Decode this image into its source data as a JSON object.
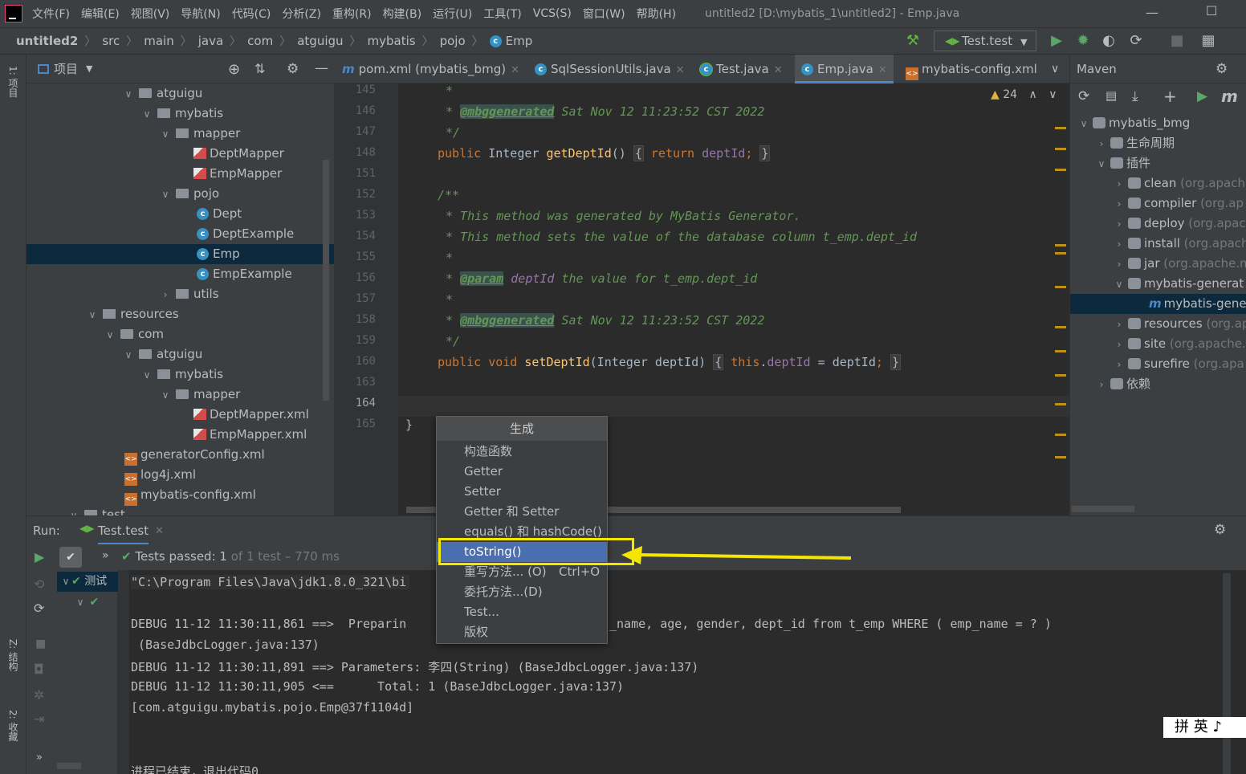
{
  "menu": [
    "文件(F)",
    "编辑(E)",
    "视图(V)",
    "导航(N)",
    "代码(C)",
    "分析(Z)",
    "重构(R)",
    "构建(B)",
    "运行(U)",
    "工具(T)",
    "VCS(S)",
    "窗口(W)",
    "帮助(H)"
  ],
  "window_title": "untitled2 [D:\\mybatis_1\\untitled2] - Emp.java",
  "breadcrumb": [
    "untitled2",
    "src",
    "main",
    "java",
    "com",
    "atguigu",
    "mybatis",
    "pojo",
    "Emp"
  ],
  "run_config": "Test.test",
  "side_labels": {
    "project": "1: 项目",
    "structure": "Z: 结构",
    "favorites": "2: 收藏"
  },
  "project_panel": {
    "title": "项目",
    "tree": [
      {
        "label": "atguigu",
        "type": "folder",
        "expanded": true
      },
      {
        "label": "mybatis",
        "type": "folder",
        "expanded": true
      },
      {
        "label": "mapper",
        "type": "folder",
        "expanded": true
      },
      {
        "label": "DeptMapper",
        "type": "mapper"
      },
      {
        "label": "EmpMapper",
        "type": "mapper"
      },
      {
        "label": "pojo",
        "type": "folder",
        "expanded": true
      },
      {
        "label": "Dept",
        "type": "class"
      },
      {
        "label": "DeptExample",
        "type": "class"
      },
      {
        "label": "Emp",
        "type": "class",
        "selected": true
      },
      {
        "label": "EmpExample",
        "type": "class"
      },
      {
        "label": "utils",
        "type": "folder",
        "expanded": false
      },
      {
        "label": "resources",
        "type": "folder",
        "expanded": true
      },
      {
        "label": "com",
        "type": "folder",
        "expanded": true
      },
      {
        "label": "atguigu",
        "type": "folder",
        "expanded": true
      },
      {
        "label": "mybatis",
        "type": "folder",
        "expanded": true
      },
      {
        "label": "mapper",
        "type": "folder",
        "expanded": true
      },
      {
        "label": "DeptMapper.xml",
        "type": "mapper"
      },
      {
        "label": "EmpMapper.xml",
        "type": "mapper"
      },
      {
        "label": "generatorConfig.xml",
        "type": "xml"
      },
      {
        "label": "log4j.xml",
        "type": "xml"
      },
      {
        "label": "mybatis-config.xml",
        "type": "xml"
      },
      {
        "label": "test",
        "type": "folder",
        "expanded": true
      }
    ]
  },
  "editor_tabs": [
    {
      "label": "pom.xml (mybatis_bmg)",
      "icon": "m"
    },
    {
      "label": "SqlSessionUtils.java",
      "icon": "c"
    },
    {
      "label": "Test.java",
      "icon": "c"
    },
    {
      "label": "Emp.java",
      "icon": "c",
      "active": true
    },
    {
      "label": "mybatis-config.xml",
      "icon": "xml"
    }
  ],
  "warnings_count": "24",
  "code_lines": [
    {
      "n": "145",
      "t": " *"
    },
    {
      "n": "146",
      "t": " * @mbggenerated Sat Nov 12 11:23:52 CST 2022"
    },
    {
      "n": "147",
      "t": " */"
    },
    {
      "n": "148",
      "t": "public Integer getDeptId() { return deptId; }"
    },
    {
      "n": "151",
      "t": ""
    },
    {
      "n": "152",
      "t": "/**"
    },
    {
      "n": "153",
      "t": " * This method was generated by MyBatis Generator."
    },
    {
      "n": "154",
      "t": " * This method sets the value of the database column t_emp.dept_id"
    },
    {
      "n": "155",
      "t": " *"
    },
    {
      "n": "156",
      "t": " * @param deptId the value for t_emp.dept_id"
    },
    {
      "n": "157",
      "t": " *"
    },
    {
      "n": "158",
      "t": " * @mbggenerated Sat Nov 12 11:23:52 CST 2022"
    },
    {
      "n": "159",
      "t": " */"
    },
    {
      "n": "160",
      "t": "public void setDeptId(Integer deptId) { this.deptId = deptId; }"
    },
    {
      "n": "163",
      "t": ""
    },
    {
      "n": "164",
      "t": ""
    },
    {
      "n": "165",
      "t": "}"
    }
  ],
  "code_parts": {
    "star": "*",
    "tag_mbg": "@mbggenerated",
    "date": " Sat Nov 12 11:23:52 CST 2022",
    "close": "*/",
    "kw_public": "public",
    "type_integer": "Integer",
    "m_get": "getDeptId",
    "paren": "()",
    "ob": "{",
    "kw_return": "return",
    "f_deptId": "deptId",
    "semi": ";",
    "cb": "}",
    "open": "/**",
    "c153": "* This method was generated by MyBatis Generator.",
    "c154": "* This method sets the value of the database column t_emp.dept_id",
    "tag_param": "@param",
    "p_deptId": "deptId",
    "c156": " the value for t_emp.dept_id",
    "kw_void": "void",
    "m_set": "setDeptId",
    "sig_set": "(Integer deptId)",
    "kw_this": "this",
    "dot": ".",
    "eq": " = ",
    "endbrace": "}"
  },
  "maven": {
    "title": "Maven",
    "tree": [
      {
        "label": "mybatis_bmg",
        "suffix": ""
      },
      {
        "label": "生命周期",
        "suffix": ""
      },
      {
        "label": "插件",
        "suffix": ""
      },
      {
        "label": "clean",
        "suffix": " (org.apach"
      },
      {
        "label": "compiler",
        "suffix": " (org.ap"
      },
      {
        "label": "deploy",
        "suffix": " (org.apac"
      },
      {
        "label": "install",
        "suffix": " (org.apach"
      },
      {
        "label": "jar",
        "suffix": " (org.apache.m"
      },
      {
        "label": "mybatis-generat",
        "suffix": ""
      },
      {
        "label": "mybatis-gene",
        "suffix": ""
      },
      {
        "label": "resources",
        "suffix": " (org.ap"
      },
      {
        "label": "site",
        "suffix": " (org.apache."
      },
      {
        "label": "surefire",
        "suffix": " (org.apa"
      },
      {
        "label": "依赖",
        "suffix": ""
      }
    ]
  },
  "run": {
    "label": "Run:",
    "tab": "Test.test",
    "passed": "Tests passed: 1",
    "passed_detail": " of 1 test – 770 ms",
    "tree_label": "测试",
    "console": [
      "\"C:\\Program Files\\Java\\jdk1.8.0_321\\bi",
      "",
      "DEBUG 11-12 11:30:11,861 ==>  Preparin",
      " (BaseJdbcLogger.java:137)",
      "DEBUG 11-12 11:30:11,891 ==> Parameters: 李四(String) (BaseJdbcLogger.java:137)",
      "DEBUG 11-12 11:30:11,905 <==      Total: 1 (BaseJdbcLogger.java:137)",
      "[com.atguigu.mybatis.pojo.Emp@37f1104d]",
      "",
      "",
      "进程已结束，退出代码0"
    ],
    "console_line3_tail": "_name, age, gender, dept_id from t_emp WHERE ( emp_name = ? )"
  },
  "generate_popup": {
    "title": "生成",
    "items": [
      {
        "label": "构造函数",
        "shortcut": ""
      },
      {
        "label": "Getter",
        "shortcut": ""
      },
      {
        "label": "Setter",
        "shortcut": ""
      },
      {
        "label": "Getter 和 Setter",
        "shortcut": ""
      },
      {
        "label": "equals() 和 hashCode()",
        "shortcut": ""
      },
      {
        "label": "toString()",
        "shortcut": "",
        "selected": true
      },
      {
        "label": "重写方法... (O)",
        "shortcut": "Ctrl+O"
      },
      {
        "label": "委托方法...(D)",
        "shortcut": ""
      },
      {
        "label": "Test...",
        "shortcut": ""
      },
      {
        "label": "版权",
        "shortcut": ""
      }
    ]
  },
  "ime": "拼 英 ♪",
  "colors": {
    "highlight_box": "#f5e600",
    "selection": "#4b6eaf",
    "accent": "#4a88c7"
  }
}
